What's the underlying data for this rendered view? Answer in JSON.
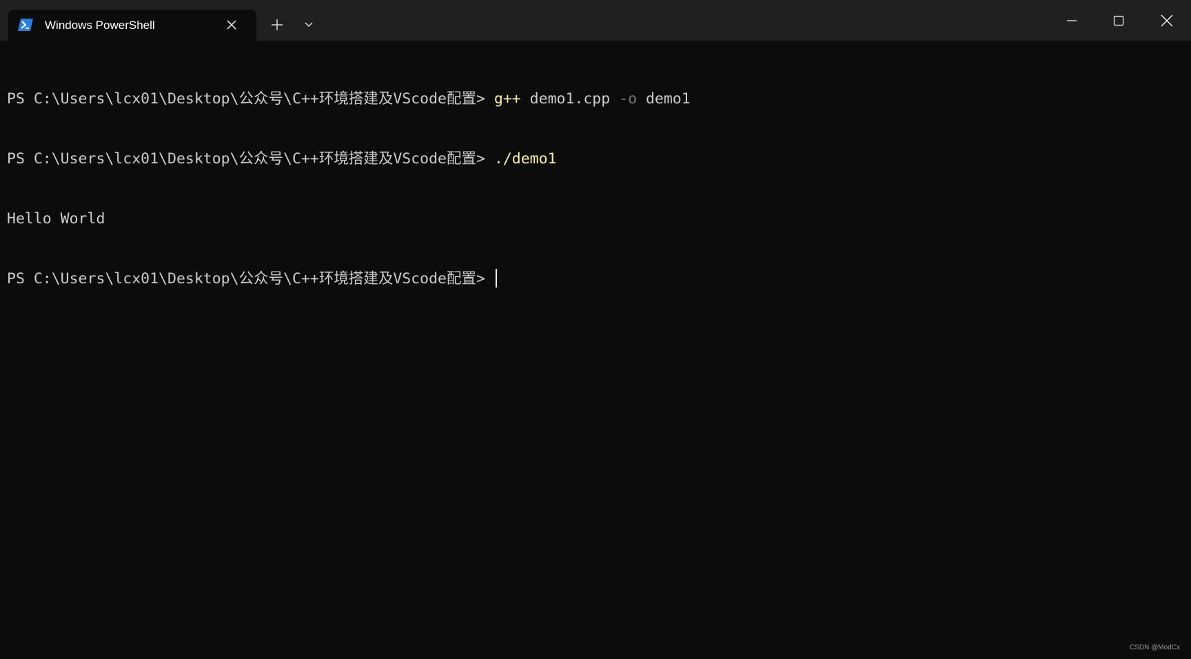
{
  "window": {
    "tab_title": "Windows PowerShell",
    "icons": {
      "tab": "powershell-icon",
      "tab_close": "close-icon",
      "new_tab": "plus-icon",
      "dropdown": "chevron-down-icon",
      "minimize": "minimize-icon",
      "maximize": "maximize-icon",
      "close": "close-icon"
    }
  },
  "terminal": {
    "lines": [
      {
        "prompt": "PS C:\\Users\\lcx01\\Desktop\\公众号\\C++环境搭建及VScode配置> ",
        "command": "g++",
        "rest1": " demo1.cpp ",
        "param": "-o",
        "rest2": " demo1"
      },
      {
        "prompt": "PS C:\\Users\\lcx01\\Desktop\\公众号\\C++环境搭建及VScode配置> ",
        "command": "./demo1"
      },
      {
        "output": "Hello World"
      },
      {
        "prompt": "PS C:\\Users\\lcx01\\Desktop\\公众号\\C++环境搭建及VScode配置> "
      }
    ]
  },
  "watermark": "CSDN @ModCx",
  "colors": {
    "background": "#0c0c0c",
    "titlebar": "#202020",
    "text": "#cccccc",
    "command": "#f9f1a5",
    "parameter": "#767676",
    "powershell_icon": "#2b7fd8"
  }
}
